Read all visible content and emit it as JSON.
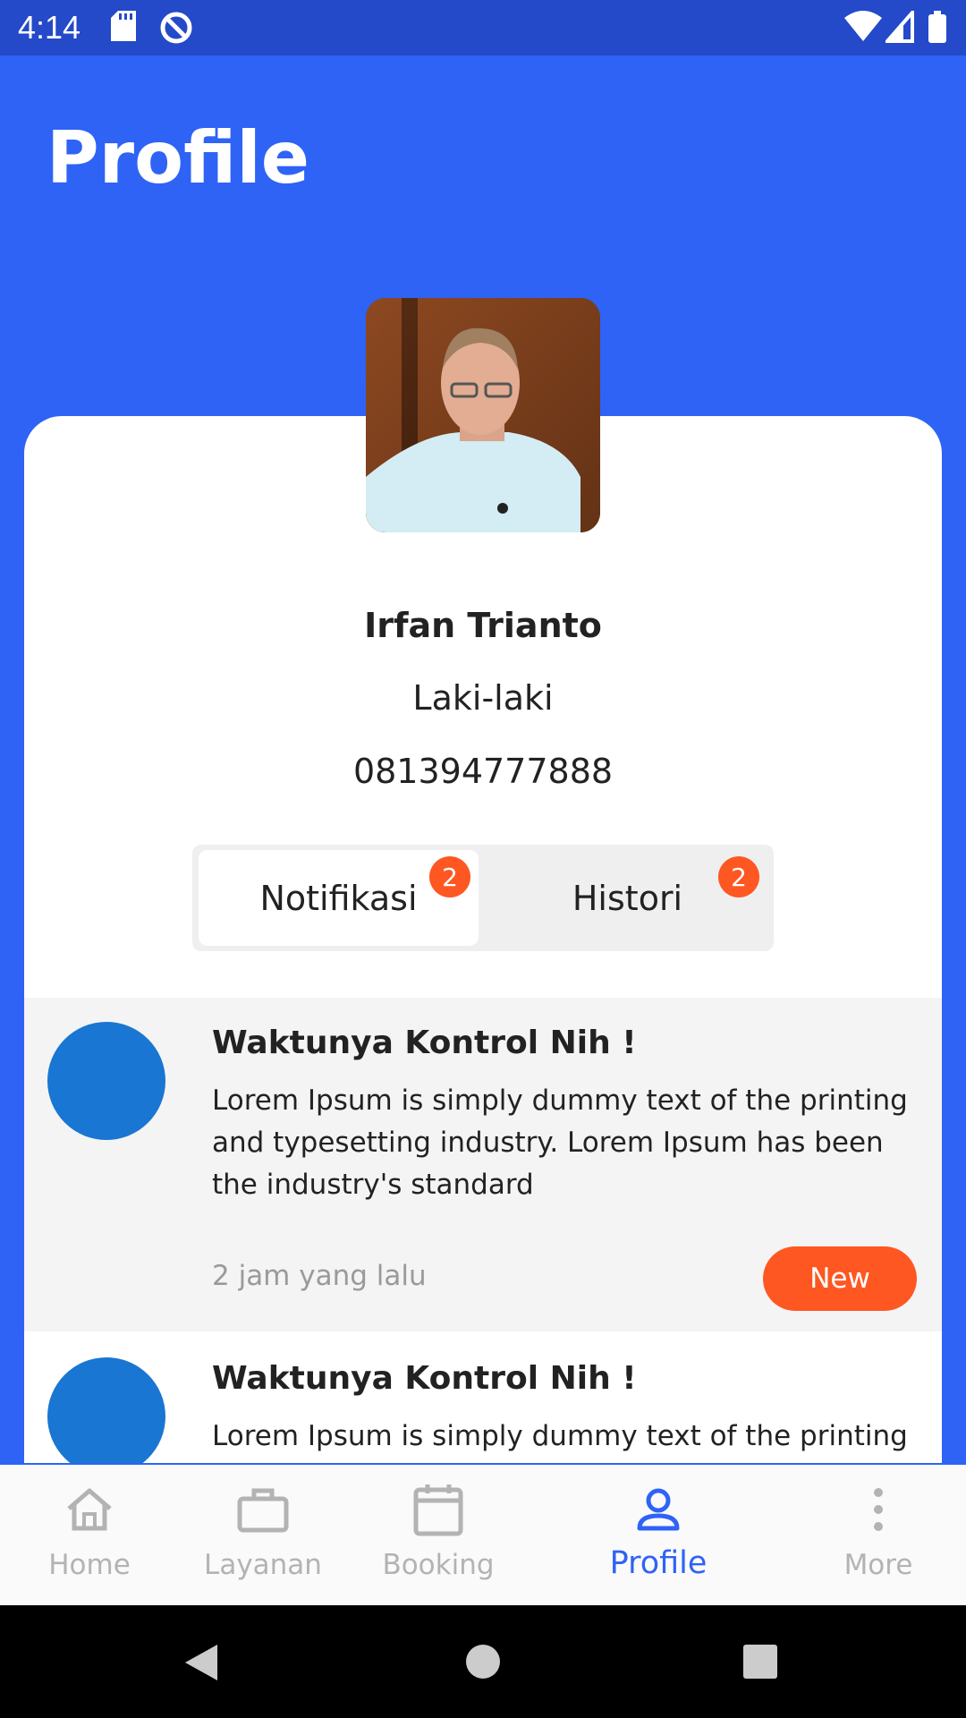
{
  "status_bar": {
    "time": "4:14"
  },
  "header": {
    "title": "Profile"
  },
  "profile": {
    "name": "Irfan Trianto",
    "gender": "Laki-laki",
    "phone": "081394777888"
  },
  "tabs": [
    {
      "label": "Notifikasi",
      "badge": "2",
      "active": true
    },
    {
      "label": "Histori",
      "badge": "2",
      "active": false
    }
  ],
  "notifications": [
    {
      "title": "Waktunya Kontrol Nih !",
      "body": "Lorem Ipsum is simply dummy text of the printing and typesetting industry. Lorem Ipsum has been the industry's standard",
      "time": "2 jam yang lalu",
      "tag": "New"
    },
    {
      "title": "Waktunya Kontrol Nih !",
      "body": "Lorem Ipsum is simply dummy text of the printing"
    }
  ],
  "bottom_nav": [
    {
      "label": "Home",
      "icon": "home-icon"
    },
    {
      "label": "Layanan",
      "icon": "briefcase-icon"
    },
    {
      "label": "Booking",
      "icon": "calendar-icon"
    },
    {
      "label": "Profile",
      "icon": "person-icon",
      "active": true
    },
    {
      "label": "More",
      "icon": "more-vertical-icon"
    }
  ],
  "colors": {
    "primary": "#2e63f6",
    "status_bar": "#2449c9",
    "accent": "#fe5722",
    "notif_avatar": "#1976d2"
  }
}
